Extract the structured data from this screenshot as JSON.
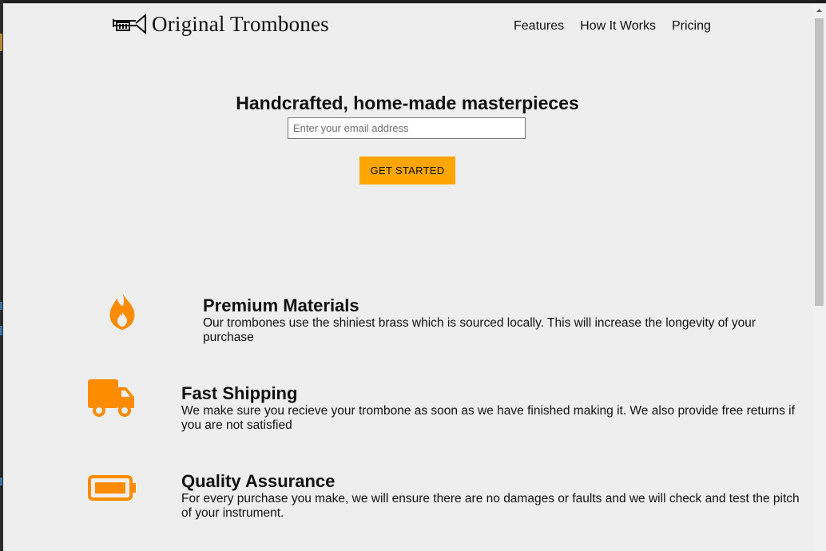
{
  "header": {
    "logo_text": "Original Trombones",
    "nav": [
      "Features",
      "How It Works",
      "Pricing"
    ]
  },
  "hero": {
    "title": "Handcrafted, home-made masterpieces",
    "email_placeholder": "Enter your email address",
    "cta_label": "GET STARTED"
  },
  "features": [
    {
      "icon": "fire-icon",
      "title": "Premium Materials",
      "description": "Our trombones use the shiniest brass which is sourced locally. This will increase the longevity of your purchase"
    },
    {
      "icon": "truck-icon",
      "title": "Fast Shipping",
      "description": "We make sure you recieve your trombone as soon as we have finished making it. We also provide free returns if you are not satisfied"
    },
    {
      "icon": "battery-icon",
      "title": "Quality Assurance",
      "description": "For every purchase you make, we will ensure there are no damages or faults and we will check and test the pitch of your instrument."
    }
  ],
  "colors": {
    "accent": "#ffa500",
    "icon": "#ff8c00",
    "background": "#eeeeee"
  }
}
